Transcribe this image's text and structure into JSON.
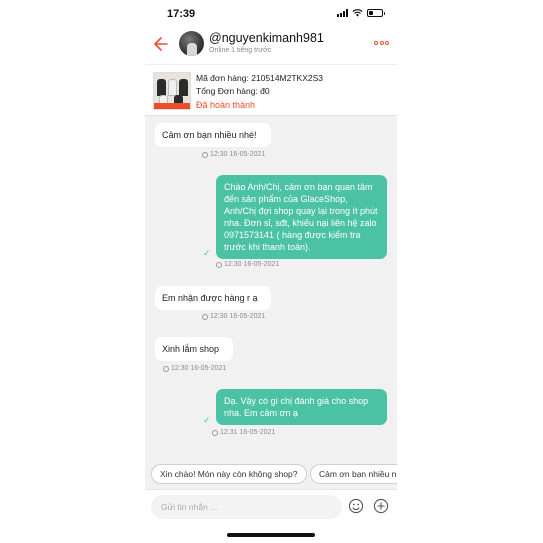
{
  "status_bar": {
    "time": "17:39"
  },
  "header": {
    "username": "@nguyenkimanh981",
    "online_status": "Online 1 tiếng trước"
  },
  "order": {
    "order_id_line": "Mã đơn hàng: 210514M2TKX2S3",
    "total_line": "Tổng Đơn hàng: đ0",
    "status": "Đã hoàn thành"
  },
  "messages": [
    {
      "side": "in",
      "text": "Cảm ơn bạn nhiều nhé!",
      "time": "12:30 16-05-2021"
    },
    {
      "side": "out",
      "text": "Chào Anh/Chị, cảm ơn bạn quan tâm đến sản phẩm của GlaceShop, Anh/Chị đợi shop quay lại trong ít phút nha. Đơn sỉ, sđt, khiếu nại liên hệ zalo 0971573141 ( hàng được kiểm tra trước khi thanh toán).",
      "time": "12:30 16-05-2021"
    },
    {
      "side": "in",
      "text": "Em nhận được hàng r ạ",
      "time": "12:30 16-05-2021"
    },
    {
      "side": "in",
      "text": "Xinh lắm shop",
      "time": "12:30 16-05-2021"
    },
    {
      "side": "out",
      "text": "Dạ. Vậy có gì chị đánh giá cho shop nha. Em cảm ơn ạ",
      "time": "12:31 16-05-2021"
    }
  ],
  "quick_replies": [
    "Xin chào! Món này còn không shop?",
    "Cảm ơn bạn nhiều n"
  ],
  "input": {
    "placeholder": "Gửi tin nhắn ..."
  },
  "icons": {
    "back": "back-arrow-icon",
    "more": "more-options-icon",
    "emoji": "emoji-icon",
    "add": "plus-icon"
  },
  "colors": {
    "accent": "#ee4d2d",
    "outgoing_bubble": "#4cc2a4",
    "chat_background": "#f1f1f1"
  }
}
